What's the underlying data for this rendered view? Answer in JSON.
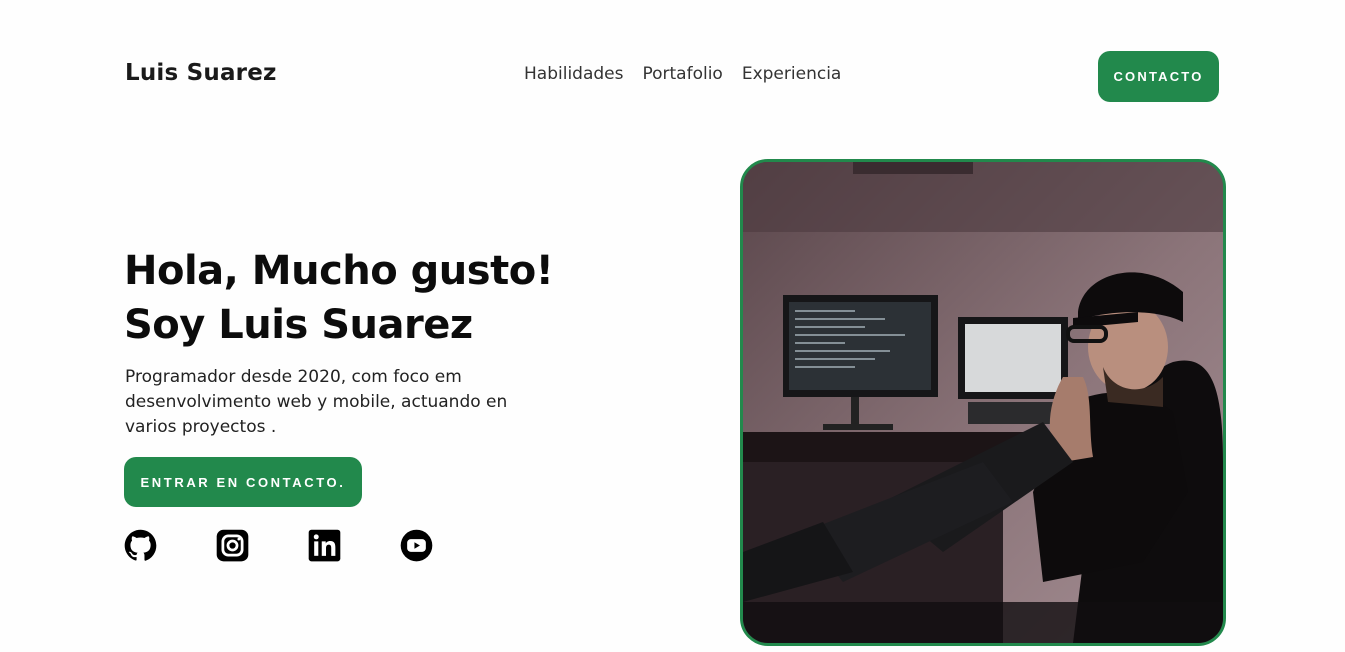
{
  "header": {
    "logo": "Luis Suarez",
    "nav": [
      "Habilidades",
      "Portafolio",
      "Experiencia"
    ],
    "cta": "CONTACTO"
  },
  "hero": {
    "title_line1": "Hola, Mucho gusto!",
    "title_line2": "Soy Luis Suarez",
    "description": "Programador desde 2020, com foco em desenvolvimento web y mobile, actuando en varios proyectos .",
    "cta": "ENTRAR EN CONTACTO.",
    "socials": [
      "github-icon",
      "instagram-icon",
      "linkedin-icon",
      "youtube-icon"
    ]
  },
  "colors": {
    "accent": "#22894c",
    "text": "#111111",
    "background": "#fefefe"
  }
}
